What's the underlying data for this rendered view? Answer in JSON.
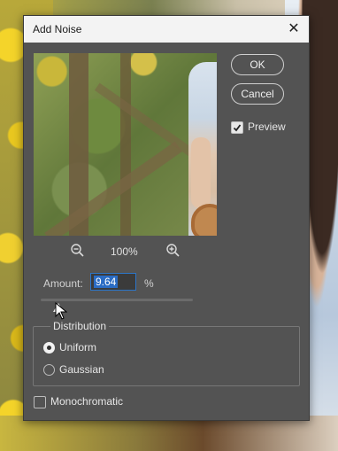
{
  "dialog": {
    "title": "Add Noise",
    "close_glyph": "✕"
  },
  "buttons": {
    "ok": "OK",
    "cancel": "Cancel"
  },
  "preview_checkbox": {
    "label": "Preview",
    "checked": true
  },
  "zoom": {
    "value": "100%"
  },
  "amount": {
    "label": "Amount:",
    "value": "9.64",
    "unit": "%"
  },
  "distribution": {
    "legend": "Distribution",
    "options": [
      {
        "label": "Uniform",
        "selected": true
      },
      {
        "label": "Gaussian",
        "selected": false
      }
    ]
  },
  "monochromatic": {
    "label": "Monochromatic",
    "checked": false
  },
  "icons": {
    "zoom_out": "zoom-out-icon",
    "zoom_in": "zoom-in-icon",
    "close": "close-icon",
    "checkmark": "checkmark-icon",
    "cursor": "mouse-pointer-icon"
  },
  "colors": {
    "dialog_bg": "#535353",
    "accent": "#2b6cc4"
  }
}
